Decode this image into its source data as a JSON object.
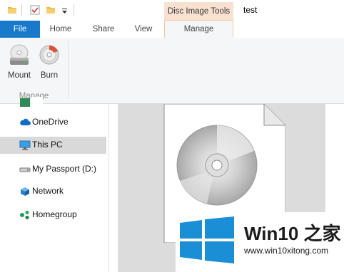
{
  "window": {
    "title": "test"
  },
  "quick_access": {
    "icons": [
      "folder-icon",
      "properties-checkbox-icon",
      "new-folder-icon",
      "customize-dropdown-icon"
    ]
  },
  "ribbon": {
    "context_header": "Disc Image Tools",
    "tabs": [
      {
        "label": "File",
        "active": false
      },
      {
        "label": "Home",
        "active": false
      },
      {
        "label": "Share",
        "active": false
      },
      {
        "label": "View",
        "active": false
      },
      {
        "label": "Manage",
        "active": true
      }
    ],
    "buttons": [
      {
        "label": "Mount",
        "icon": "disc-drive-icon"
      },
      {
        "label": "Burn",
        "icon": "burn-disc-icon"
      }
    ],
    "group_label": "Manage"
  },
  "nav_pane": {
    "items": [
      {
        "label": "OneDrive",
        "icon": "cloud-icon",
        "selected": false
      },
      {
        "label": "This PC",
        "icon": "computer-icon",
        "selected": true
      },
      {
        "label": "My Passport (D:)",
        "icon": "drive-icon",
        "selected": false
      },
      {
        "label": "Network",
        "icon": "network-icon",
        "selected": false
      },
      {
        "label": "Homegroup",
        "icon": "homegroup-icon",
        "selected": false
      }
    ]
  },
  "watermark": {
    "title": "Win10 之家",
    "url": "www.win10xitong.com"
  },
  "colors": {
    "file_tab": "#1979ca",
    "context_tab": "#f9e1d1",
    "selected_nav": "#d9d9d9",
    "win_logo": "#1b8fd6"
  }
}
